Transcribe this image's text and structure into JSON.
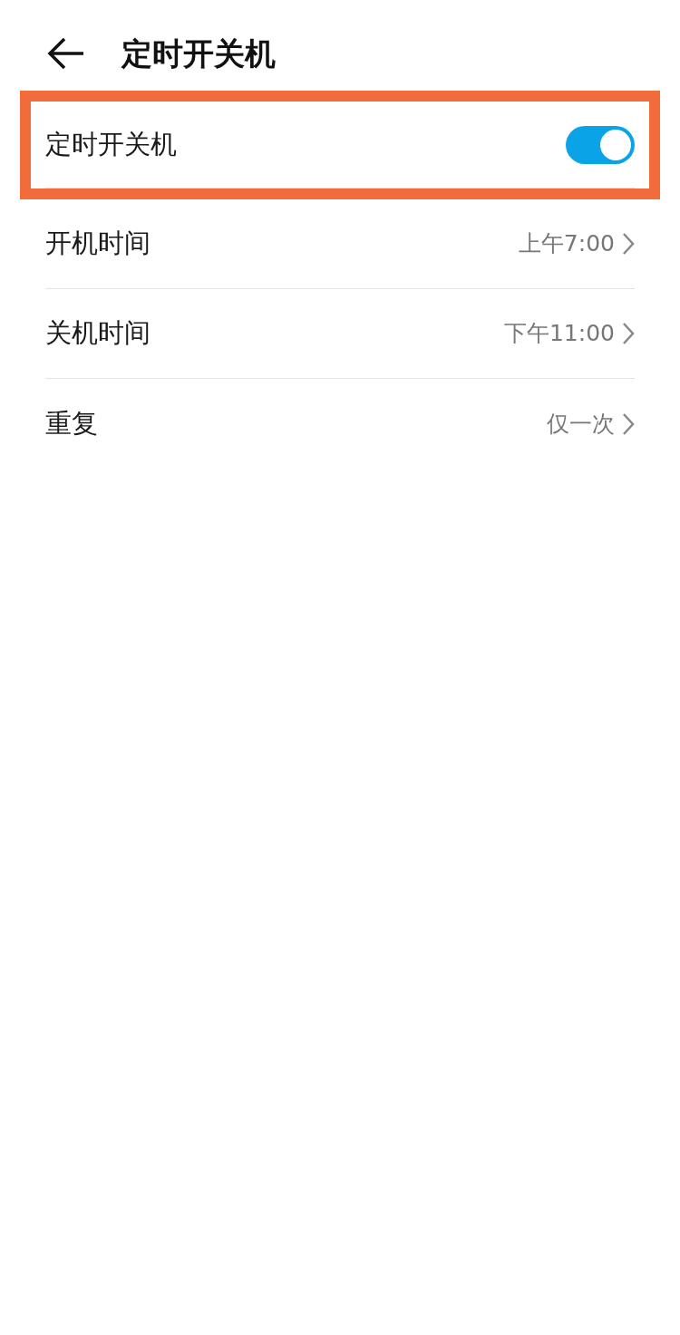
{
  "header": {
    "title": "定时开关机"
  },
  "items": [
    {
      "kind": "toggle",
      "label": "定时开关机",
      "on": true,
      "highlighted": true
    },
    {
      "kind": "link",
      "label": "开机时间",
      "value": "上午7:00",
      "highlighted": false
    },
    {
      "kind": "link",
      "label": "关机时间",
      "value": "下午11:00",
      "highlighted": false
    },
    {
      "kind": "link",
      "label": "重复",
      "value": "仅一次",
      "highlighted": false
    }
  ]
}
